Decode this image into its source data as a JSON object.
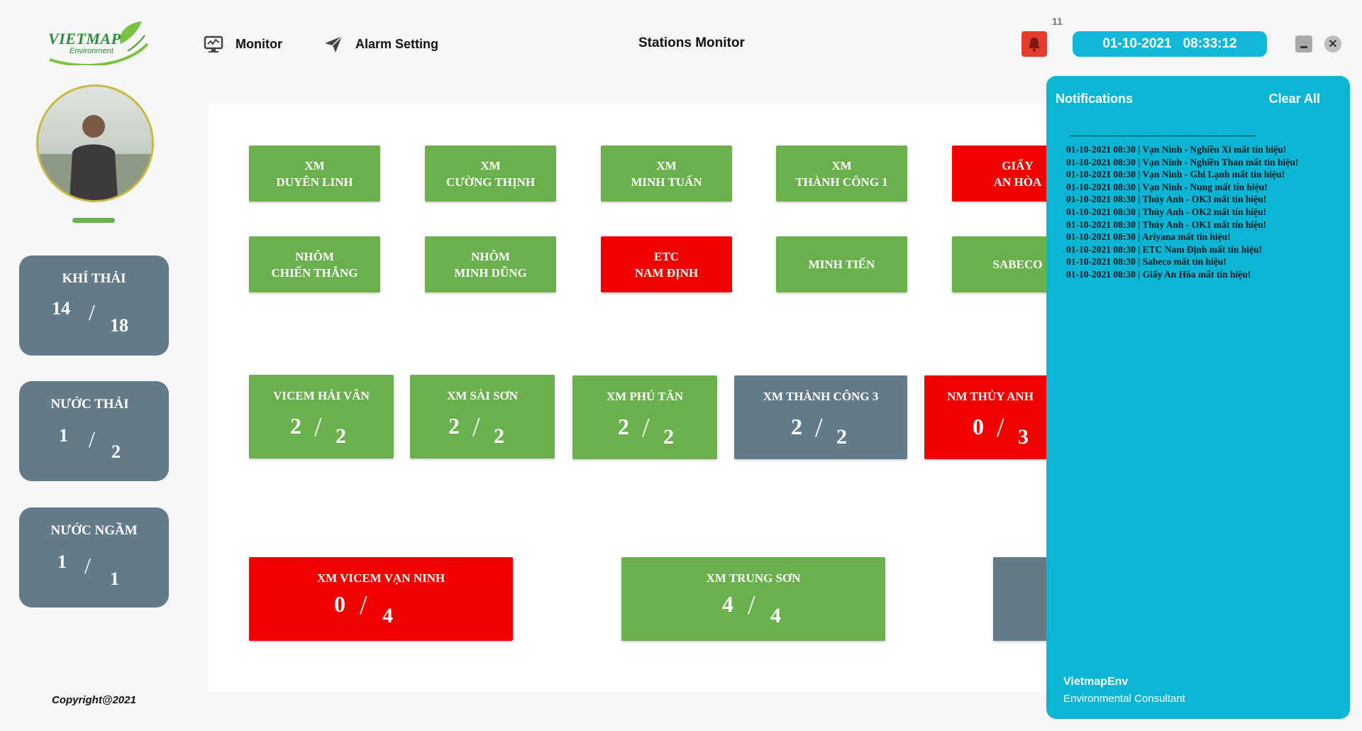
{
  "header": {
    "logo_text": "VIETMAP",
    "logo_sub": "Environment",
    "nav": [
      {
        "label": "Monitor",
        "icon": "monitor-icon"
      },
      {
        "label": "Alarm Setting",
        "icon": "paper-plane-icon"
      }
    ],
    "title": "Stations Monitor",
    "tiny_mark": "11",
    "date": "01-10-2021",
    "time": "08:33:12",
    "icons": {
      "bell": "bell-icon",
      "minimize": "minimize-icon",
      "close": "close-icon"
    },
    "colors": {
      "accent": "#12b8d8",
      "bell": "#e53b2b"
    }
  },
  "sidebar": {
    "avatar": "user-avatar",
    "categories": [
      {
        "title": "KHÍ THẢI",
        "online": "14",
        "total": "18"
      },
      {
        "title": "NƯỚC THẢI",
        "online": "1",
        "total": "2"
      },
      {
        "title": "NƯỚC NGẦM",
        "online": "1",
        "total": "1"
      }
    ],
    "copyright": "Copyright@2021"
  },
  "stations": {
    "row1": [
      {
        "l1": "XM",
        "l2": "DUYÊN LINH",
        "status": "ok"
      },
      {
        "l1": "XM",
        "l2": "CƯỜNG THỊNH",
        "status": "ok"
      },
      {
        "l1": "XM",
        "l2": "MINH TUẤN",
        "status": "ok"
      },
      {
        "l1": "XM",
        "l2": "THÀNH CÔNG 1",
        "status": "ok"
      },
      {
        "l1": "GIẤY",
        "l2": "AN HÒA",
        "status": "alarm"
      }
    ],
    "row2": [
      {
        "l1": "NHÔM",
        "l2": "CHIẾN THẮNG",
        "status": "ok"
      },
      {
        "l1": "NHÔM",
        "l2": "MINH DŨNG",
        "status": "ok"
      },
      {
        "l1": "ETC",
        "l2": "NAM ĐỊNH",
        "status": "alarm"
      },
      {
        "l1": "MINH TIẾN",
        "l2": "",
        "status": "ok"
      },
      {
        "l1": "SABECO",
        "l2": "",
        "status": "ok"
      }
    ],
    "groups": [
      {
        "name": "VICEM HẢI VÂN",
        "online": "2",
        "total": "2",
        "status": "ok"
      },
      {
        "name": "XM SÀI SƠN",
        "online": "2",
        "total": "2",
        "status": "ok"
      },
      {
        "name": "XM PHÚ TÂN",
        "online": "2",
        "total": "2",
        "status": "ok"
      },
      {
        "name": "XM THÀNH CÔNG 3",
        "online": "2",
        "total": "2",
        "status": "neutral"
      },
      {
        "name": "NM THỦY ANH",
        "online": "0",
        "total": "3",
        "status": "alarm"
      }
    ],
    "large_groups": [
      {
        "name": "XM VICEM VẠN NINH",
        "online": "0",
        "total": "4",
        "status": "alarm"
      },
      {
        "name": "XM TRUNG SƠN",
        "online": "4",
        "total": "4",
        "status": "ok"
      }
    ],
    "status_colors": {
      "ok": "#6ab04c",
      "alarm": "#f30000",
      "neutral": "#637a88"
    }
  },
  "notifications": {
    "title": "Notifications",
    "clear_all": "Clear All",
    "separator": "-------------------------------------------------------------------------------",
    "items": [
      "01-10-2021 08:30 | Vạn Ninh - Nghiền Xi mất tín hiệu!",
      "01-10-2021 08:30 | Vạn Ninh - Nghiền Than mất tín hiệu!",
      "01-10-2021 08:30 | Vạn Ninh - Ghi Lạnh mất tín hiệu!",
      "01-10-2021 08:30 | Vạn Ninh - Nung mất tín hiệu!",
      "01-10-2021 08:30 | Thủy Anh - OK3 mất tín hiệu!",
      "01-10-2021 08:30 | Thủy Anh - OK2 mất tín hiệu!",
      "01-10-2021 08:30 | Thủy Anh - OK1 mất tín hiệu!",
      "01-10-2021 08:30 | Ariyana mất tín hiệu!",
      "01-10-2021 08:30 | ETC Nam Định mất tín hiệu!",
      "01-10-2021 08:30 | Sabeco mất tín hiệu!",
      "01-10-2021 08:30 | Giấy An Hòa mất tín hiệu!"
    ],
    "footer_title": "VietmapEnv",
    "footer_sub": "Environmental Consultant",
    "color": "#0db5d4"
  }
}
